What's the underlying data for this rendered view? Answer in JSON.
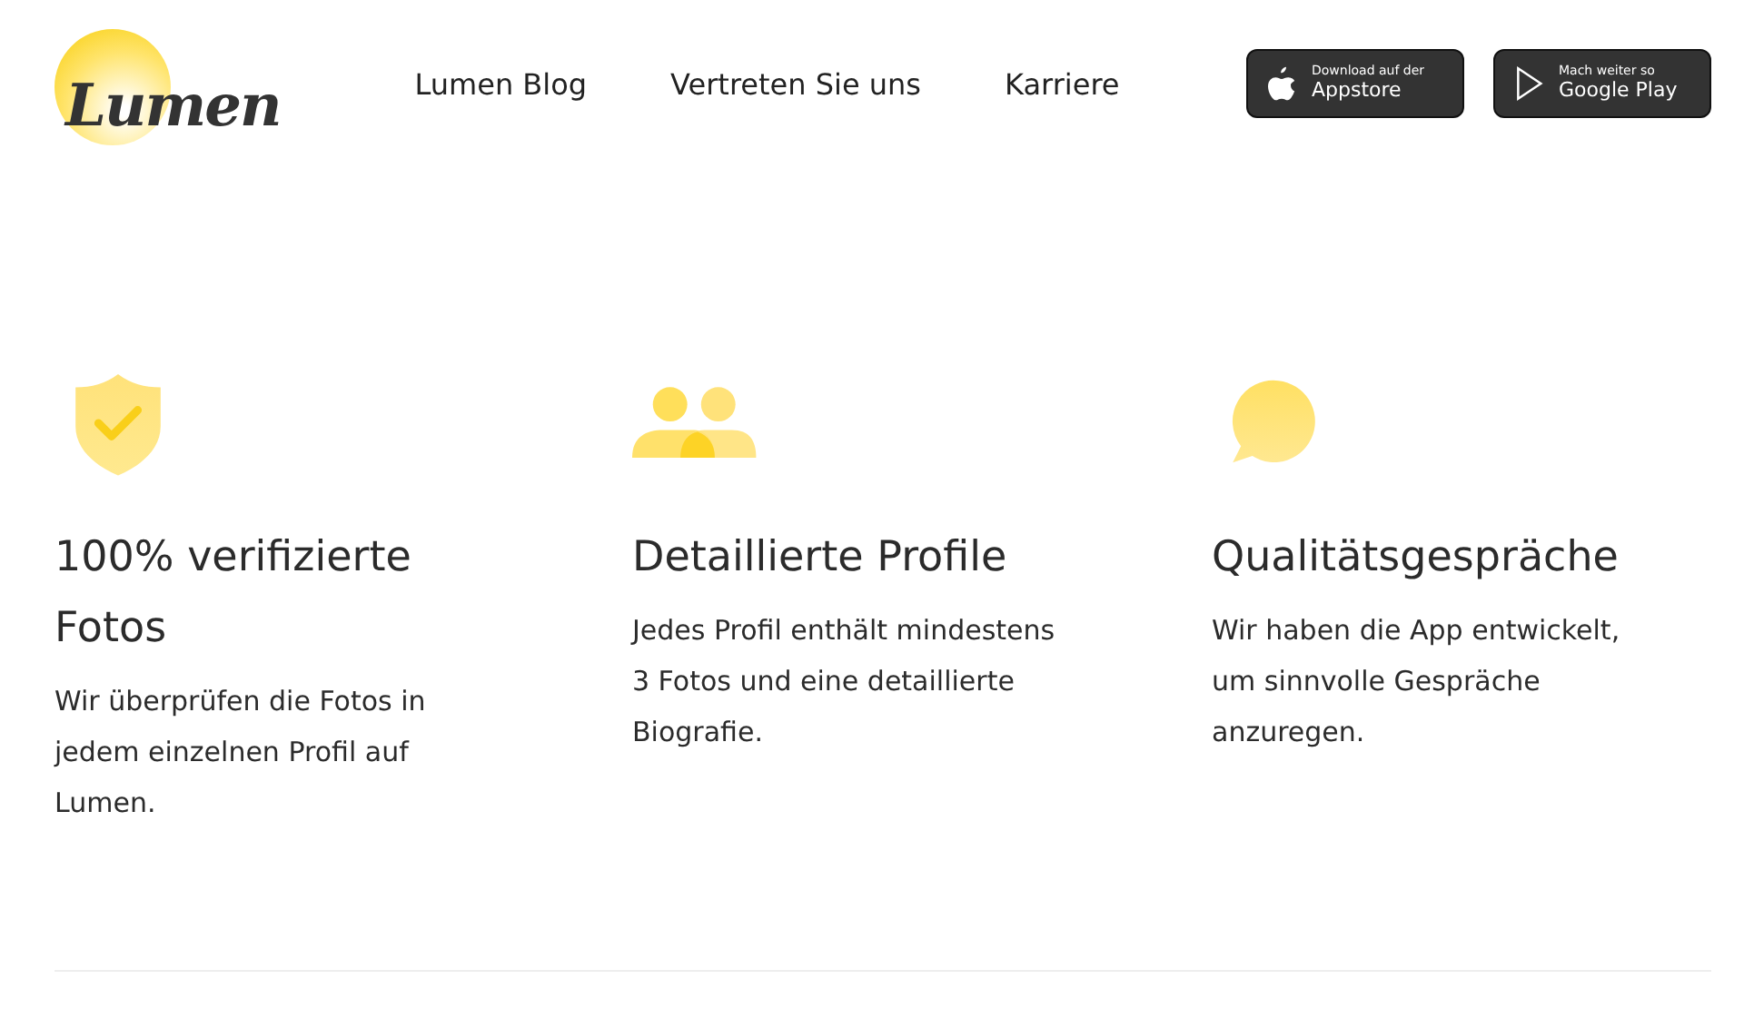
{
  "logo": "Lumen",
  "nav": [
    "Lumen Blog",
    "Vertreten Sie uns",
    "Karriere"
  ],
  "store_buttons": [
    {
      "kind": "apple",
      "small": "Download auf der",
      "big": "Appstore"
    },
    {
      "kind": "play",
      "small": "Mach weiter so",
      "big": "Google Play"
    }
  ],
  "features": [
    {
      "kind": "shield",
      "title": "100% verifizierte Fotos",
      "text": "Wir überprüfen die Fotos in jedem einzelnen Profil auf Lumen."
    },
    {
      "kind": "people",
      "title": "Detaillierte Profile",
      "text": "Jedes Profil enthält mindestens 3 Fotos und eine detaillierte Biografie."
    },
    {
      "kind": "chat",
      "title": "Qualitätsgespräche",
      "text": "Wir haben die App entwickelt, um sinnvolle Gespräche anzuregen."
    }
  ]
}
